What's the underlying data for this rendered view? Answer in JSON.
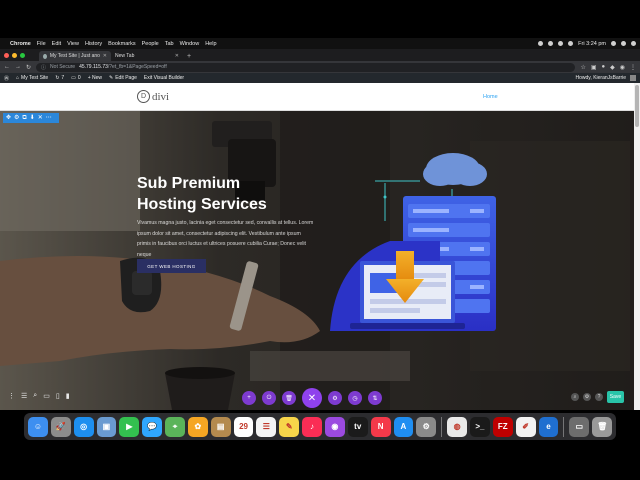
{
  "menubar": {
    "app": "Chrome",
    "items": [
      "File",
      "Edit",
      "View",
      "History",
      "Bookmarks",
      "People",
      "Tab",
      "Window",
      "Help"
    ],
    "clock": "Fri 3:24 pm"
  },
  "tabs": [
    {
      "label": "My Test Site | Just another W",
      "active": true
    },
    {
      "label": "New Tab",
      "active": false
    }
  ],
  "address": {
    "security": "Not Secure",
    "host": "45.79.115.73",
    "path": "/?et_fb=1&PageSpeed=off"
  },
  "wp_admin": {
    "site": "My Test Site",
    "comments": "7",
    "updates": "0",
    "new": "+ New",
    "edit_page": "Edit Page",
    "exit_builder": "Exit Visual Builder",
    "howdy": "Howdy, KieranJsBarrie"
  },
  "site": {
    "logo_text": "divi",
    "nav_home": "Home"
  },
  "hero": {
    "title_line1": "Sub Premium",
    "title_line2": "Hosting Services",
    "text": "Vivamus magna justo, lacinia eget consectetur sed, convallis at tellus. Lorem ipsum dolor sit amet, consectetur adipiscing elit. Vestibulum ante ipsum primis in faucibus orci luctus et ultrices posuere cubilia Curae; Donec velit neque",
    "button": "GET WEB HOSTING"
  },
  "builder": {
    "save": "Save",
    "center_buttons": [
      "+",
      "⏻",
      "🗑",
      "✕",
      "⚙",
      "◷",
      "⇅"
    ]
  },
  "dock": {
    "icons": [
      {
        "name": "finder-icon",
        "color": "#3d8ff0",
        "glyph": "☺"
      },
      {
        "name": "launchpad-icon",
        "color": "#8c8c8c",
        "glyph": "🚀"
      },
      {
        "name": "safari-icon",
        "color": "#1d8ff0",
        "glyph": "◎"
      },
      {
        "name": "photos-app-icon",
        "color": "#6a9bd1",
        "glyph": "▣"
      },
      {
        "name": "facetime-icon",
        "color": "#33c04f",
        "glyph": "▶"
      },
      {
        "name": "messages-icon",
        "color": "#2fa7ff",
        "glyph": "💬"
      },
      {
        "name": "maps-icon",
        "color": "#5bb45a",
        "glyph": "⌖"
      },
      {
        "name": "photos-icon",
        "color": "#f5a623",
        "glyph": "✿"
      },
      {
        "name": "notes-app-icon",
        "color": "#b48a4e",
        "glyph": "▤"
      },
      {
        "name": "calendar-icon",
        "color": "#ffffff",
        "glyph": "29"
      },
      {
        "name": "reminders-icon",
        "color": "#f4f4f4",
        "glyph": "☰"
      },
      {
        "name": "notes-icon",
        "color": "#f7d54a",
        "glyph": "✎"
      },
      {
        "name": "music-icon",
        "color": "#fa2d55",
        "glyph": "♪"
      },
      {
        "name": "podcasts-icon",
        "color": "#9b4ae0",
        "glyph": "◉"
      },
      {
        "name": "tv-icon",
        "color": "#1b1b1b",
        "glyph": "tv"
      },
      {
        "name": "news-icon",
        "color": "#f4394a",
        "glyph": "N"
      },
      {
        "name": "app-store-icon",
        "color": "#1f8ef1",
        "glyph": "A"
      },
      {
        "name": "system-preferences-icon",
        "color": "#8a8a8a",
        "glyph": "⚙"
      },
      {
        "name": "chrome-icon",
        "color": "#e9e9e9",
        "glyph": "◍"
      },
      {
        "name": "terminal-icon",
        "color": "#1a1a1a",
        "glyph": ">_"
      },
      {
        "name": "filezilla-icon",
        "color": "#bf0000",
        "glyph": "FZ"
      },
      {
        "name": "textedit-icon",
        "color": "#f2f2f2",
        "glyph": "✐"
      },
      {
        "name": "edge-icon",
        "color": "#1f6fd0",
        "glyph": "e"
      },
      {
        "name": "folder-icon",
        "color": "#6d6d6d",
        "glyph": "▭"
      },
      {
        "name": "trash-icon",
        "color": "#9a9a9a",
        "glyph": "🗑"
      }
    ]
  }
}
